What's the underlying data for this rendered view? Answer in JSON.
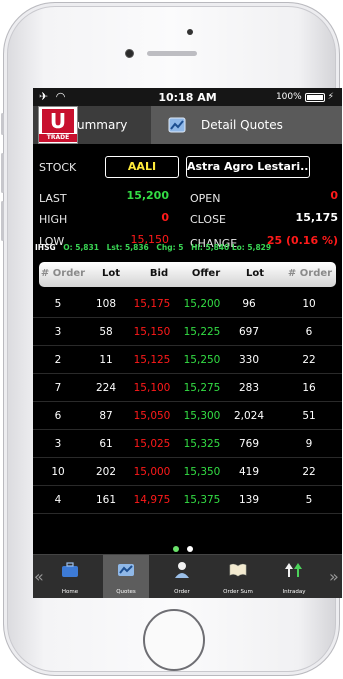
{
  "status": {
    "time": "10:18 AM",
    "battery": "100%",
    "battery_level": 1.0
  },
  "logo": {
    "main": "U",
    "sub": "TRADE"
  },
  "tabs": {
    "summary": "ummary",
    "detail": "Detail Quotes"
  },
  "stock": {
    "label": "STOCK",
    "code": "AALI",
    "name": "Astra Agro Lestari...",
    "last_label": "LAST",
    "last": "15,200",
    "open_label": "OPEN",
    "open": "0",
    "high_label": "HIGH",
    "high": "0",
    "close_label": "CLOSE",
    "close": "15,175",
    "low_label": "LOW",
    "low": "15,150",
    "change_label": "CHANGE",
    "change": "25  (0.16 %)"
  },
  "ihsg": {
    "label": "IHSG",
    "open": "O: 5,831",
    "last": "Lst: 5,836",
    "chg": "Chg: 5",
    "hi_lo": "Hi: 5,840  Lo: 5,829"
  },
  "orderbook": {
    "headers": [
      "# Order",
      "Lot",
      "Bid",
      "Offer",
      "Lot",
      "# Order"
    ],
    "rows": [
      [
        "5",
        "108",
        "15,175",
        "15,200",
        "96",
        "10"
      ],
      [
        "3",
        "58",
        "15,150",
        "15,225",
        "697",
        "6"
      ],
      [
        "2",
        "11",
        "15,125",
        "15,250",
        "330",
        "22"
      ],
      [
        "7",
        "224",
        "15,100",
        "15,275",
        "283",
        "16"
      ],
      [
        "6",
        "87",
        "15,050",
        "15,300",
        "2,024",
        "51"
      ],
      [
        "3",
        "61",
        "15,025",
        "15,325",
        "769",
        "9"
      ],
      [
        "10",
        "202",
        "15,000",
        "15,350",
        "419",
        "22"
      ],
      [
        "4",
        "161",
        "14,975",
        "15,375",
        "139",
        "5"
      ]
    ]
  },
  "nav": {
    "items": [
      "Home",
      "Quotes",
      "Order",
      "Order Sum",
      "Intraday"
    ],
    "left_arrow": "«",
    "right_arrow": "»"
  },
  "colors": {
    "up": "#33dd44",
    "down": "#ff1a1a",
    "brand": "#c8102e"
  }
}
